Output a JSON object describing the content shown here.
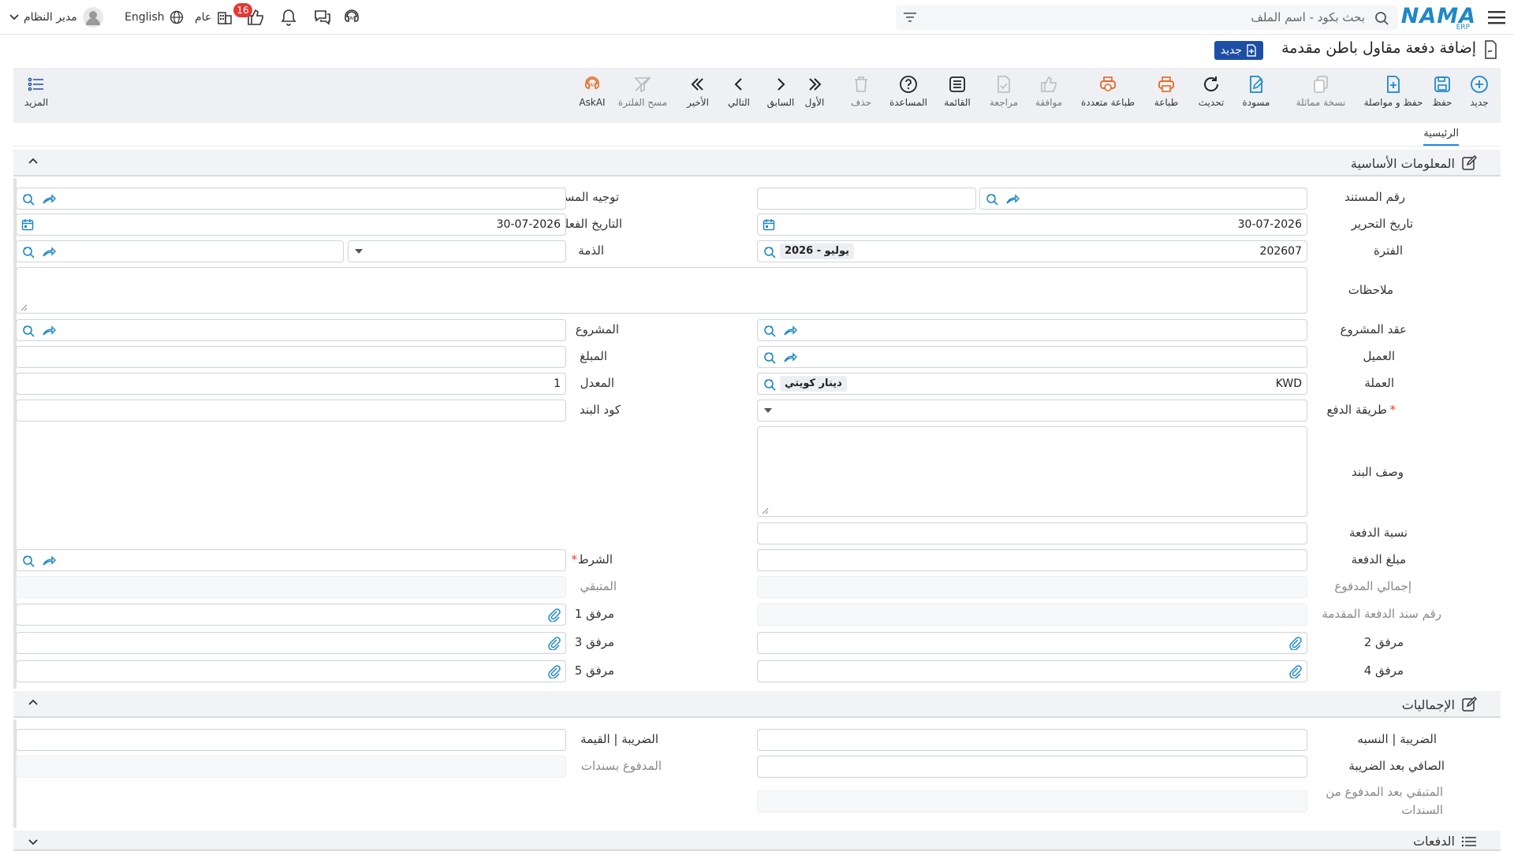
{
  "topbar": {
    "brand": "NAMA",
    "brand_sub": "ERP",
    "search_placeholder": "بحث بكود - اسم الملف",
    "user_name": "مدير النظام",
    "language": "English",
    "scope": "عام",
    "notifications_count": "16"
  },
  "page": {
    "title": "إضافة دفعة مقاول باطن مقدمة",
    "status_badge": "جديد"
  },
  "toolbar": {
    "new": "جديد",
    "save": "حفظ",
    "save_continue": "حفظ و مواصلة",
    "duplicate": "نسخة مماثلة",
    "draft": "مسودة",
    "refresh": "تحديث",
    "print": "طباعة",
    "multi_print": "طباعة متعددة",
    "approve": "موافقة",
    "review": "مراجعة",
    "list": "القائمة",
    "help": "المساعدة",
    "delete": "حذف",
    "first": "الأول",
    "previous": "السابق",
    "next": "التالي",
    "last": "الأخير",
    "clear_filter": "مسح الفلترة",
    "ask_ai": "AskAI",
    "more": "المزيد"
  },
  "tabs": {
    "main": "الرئيسية"
  },
  "basic": {
    "title": "المعلومات الأساسية",
    "doc_number": "رقم المستند",
    "doc_direction": "توجيه المستند",
    "edit_date": "تاريخ التحرير",
    "edit_date_value": "30-07-2026",
    "actual_date": "التاريخ الفعلي",
    "actual_date_value": "30-07-2026",
    "period": "الفترة",
    "period_value": "202607",
    "period_chip": "2026 - يوليو",
    "liability": "الذمة",
    "notes": "ملاحظات",
    "project_contract": "عقد المشروع",
    "project": "المشروع",
    "customer": "العميل",
    "amount": "المبلغ",
    "currency": "العملة",
    "currency_value": "KWD",
    "currency_chip": "دينار كويتي",
    "rate": "المعدل",
    "rate_value": "1",
    "payment_method": "طريقة الدفع",
    "item_code": "كود البند",
    "item_desc": "وصف البند",
    "payment_percent": "نسبة الدفعة",
    "payment_amount": "مبلغ الدفعة",
    "condition": "الشرط",
    "total_paid": "إجمالي المدفوع",
    "remaining": "المتبقي",
    "advance_voucher_no": "رقم سند الدفعة المقدمة",
    "attach1": "مرفق 1",
    "attach2": "مرفق 2",
    "attach3": "مرفق 3",
    "attach4": "مرفق 4",
    "attach5": "مرفق 5"
  },
  "totals": {
    "title": "الإجماليات",
    "tax_percent": "الضريبة | النسبه",
    "tax_value": "الضريبة | القيمة",
    "net_after_tax": "الصافي بعد الضريبة",
    "paid_by_vouchers": "المدفوع بسندات",
    "remaining_after_paid_line1": "المتبقي بعد المدفوع من",
    "remaining_after_paid_line2": "السندات"
  },
  "payments": {
    "title": "الدفعات"
  }
}
